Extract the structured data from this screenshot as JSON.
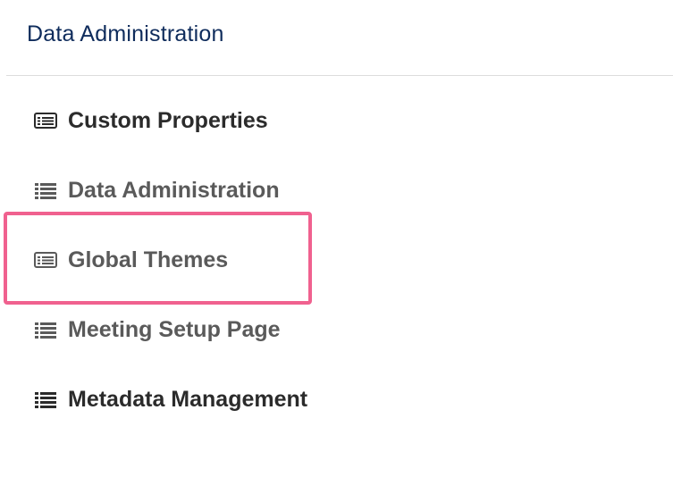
{
  "header": {
    "title": "Data Administration"
  },
  "menu": {
    "items": [
      {
        "label": "Custom Properties",
        "icon": "card-list-icon"
      },
      {
        "label": "Data Administration",
        "icon": "list-icon"
      },
      {
        "label": "Global Themes",
        "icon": "card-list-icon"
      },
      {
        "label": "Meeting Setup Page",
        "icon": "list-icon"
      },
      {
        "label": "Metadata Management",
        "icon": "list-icon"
      }
    ]
  },
  "colors": {
    "title": "#0f2c5c",
    "highlight_border": "#f0618f",
    "label_dark": "#2b2b2b",
    "label_mid": "#5a5a5a"
  }
}
